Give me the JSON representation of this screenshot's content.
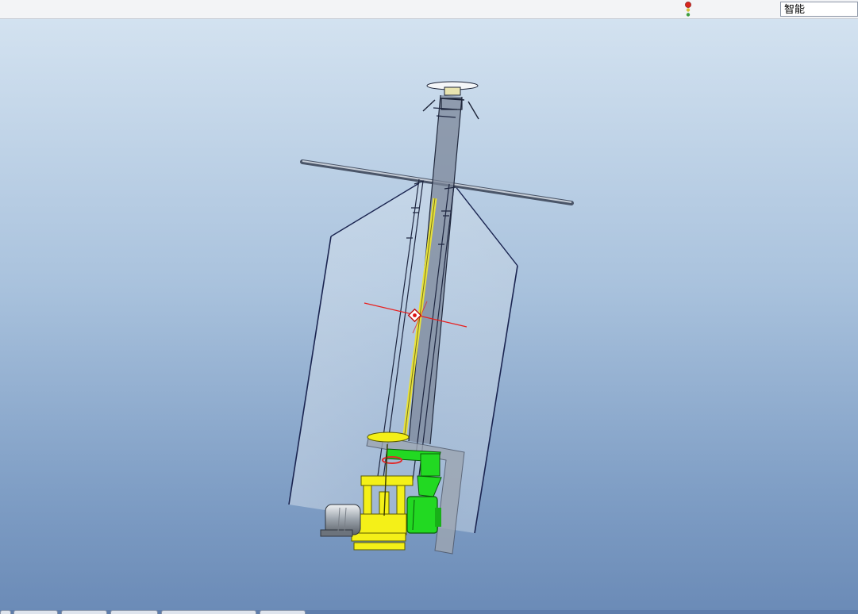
{
  "toolbar": {
    "filter_select": {
      "value": "智能"
    }
  },
  "viewport": {
    "background_top": "#d3e2f0",
    "background_bottom": "#6b8bb7",
    "highlight_yellow": "#f4f018",
    "highlight_green": "#22d922",
    "axis_red": "#e8201f"
  },
  "bottom_tabs": [
    "",
    "",
    "",
    "",
    "",
    ""
  ]
}
